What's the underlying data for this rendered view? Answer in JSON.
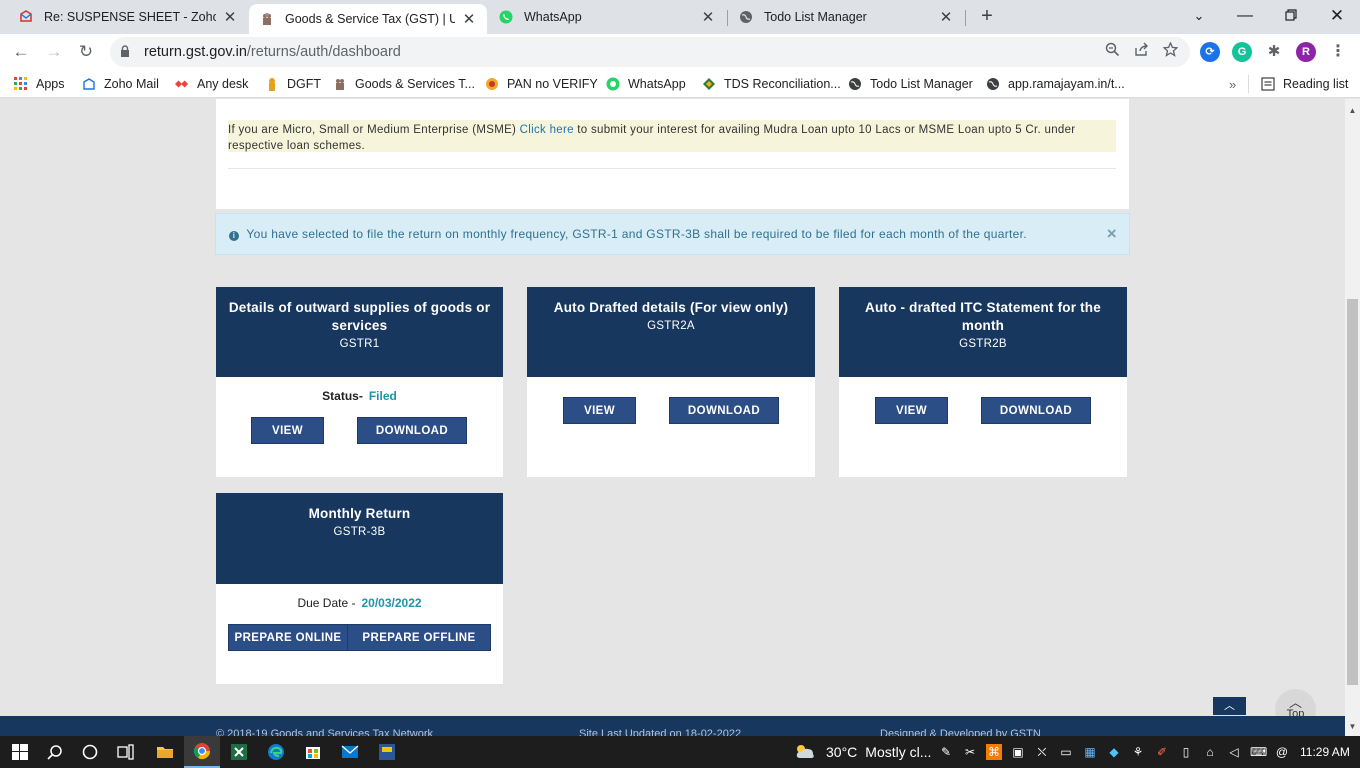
{
  "tabs": [
    {
      "title": "Re: SUSPENSE SHEET - Zoho Mai",
      "icon": "zoho-mail-icon"
    },
    {
      "title": "Goods & Service Tax (GST) | User",
      "icon": "gst-emblem-icon"
    },
    {
      "title": "WhatsApp",
      "icon": "whatsapp-icon"
    },
    {
      "title": "Todo List Manager",
      "icon": "globe-icon"
    }
  ],
  "address": {
    "host": "return.gst.gov.in",
    "path": "/returns/auth/dashboard"
  },
  "profile_initial": "R",
  "bookmarks": [
    {
      "label": "Apps",
      "icon": "apps-grid-icon"
    },
    {
      "label": "Zoho Mail",
      "icon": "zoho-mail-icon"
    },
    {
      "label": "Any desk",
      "icon": "anydesk-icon"
    },
    {
      "label": "DGFT",
      "icon": "dgft-icon"
    },
    {
      "label": "Goods & Services T...",
      "icon": "gst-emblem-icon"
    },
    {
      "label": "PAN no VERIFY",
      "icon": "pan-icon"
    },
    {
      "label": "WhatsApp",
      "icon": "whatsapp-icon"
    },
    {
      "label": "TDS Reconciliation...",
      "icon": "tds-icon"
    },
    {
      "label": "Todo List Manager",
      "icon": "globe-icon"
    },
    {
      "label": "app.ramajayam.in/t...",
      "icon": "globe-icon"
    }
  ],
  "reading_list": "Reading list",
  "msme": {
    "prefix": "If you are Micro, Small or Medium Enterprise (MSME) ",
    "link": "Click here",
    "suffix": " to submit your interest for availing Mudra Loan upto 10 Lacs or MSME Loan upto 5 Cr. under respective loan schemes."
  },
  "alert": "You have selected to file the return on monthly frequency, GSTR-1 and GSTR-3B shall be required to be filed for each month of the quarter.",
  "tiles": {
    "gstr1": {
      "title": "Details of outward supplies of goods or services",
      "code": "GSTR1",
      "status_label": "Status-",
      "status_value": "Filed",
      "view": "VIEW",
      "download": "DOWNLOAD"
    },
    "gstr2a": {
      "title": "Auto Drafted details (For view only)",
      "code": "GSTR2A",
      "view": "VIEW",
      "download": "DOWNLOAD"
    },
    "gstr2b": {
      "title": "Auto - drafted ITC Statement for the month",
      "code": "GSTR2B",
      "view": "VIEW",
      "download": "DOWNLOAD"
    },
    "gstr3b": {
      "title": "Monthly Return",
      "code": "GSTR-3B",
      "due_label": "Due Date -",
      "due_value": "20/03/2022",
      "prepare_online": "PREPARE ONLINE",
      "prepare_offline": "PREPARE OFFLINE"
    }
  },
  "top_label": "Top",
  "footer": {
    "copyright": "© 2018-19 Goods and Services Tax Network",
    "updated": "Site Last Updated on 18-02-2022",
    "developed": "Designed & Developed by GSTN"
  },
  "taskbar": {
    "weather_temp": "30°C",
    "weather_desc": "Mostly cl...",
    "time": "11:29 AM"
  },
  "colors": {
    "header_navy": "#17375e",
    "button_blue": "#2c4e86",
    "status_teal": "#1f93a8",
    "alert_bg": "#d9edf7"
  }
}
